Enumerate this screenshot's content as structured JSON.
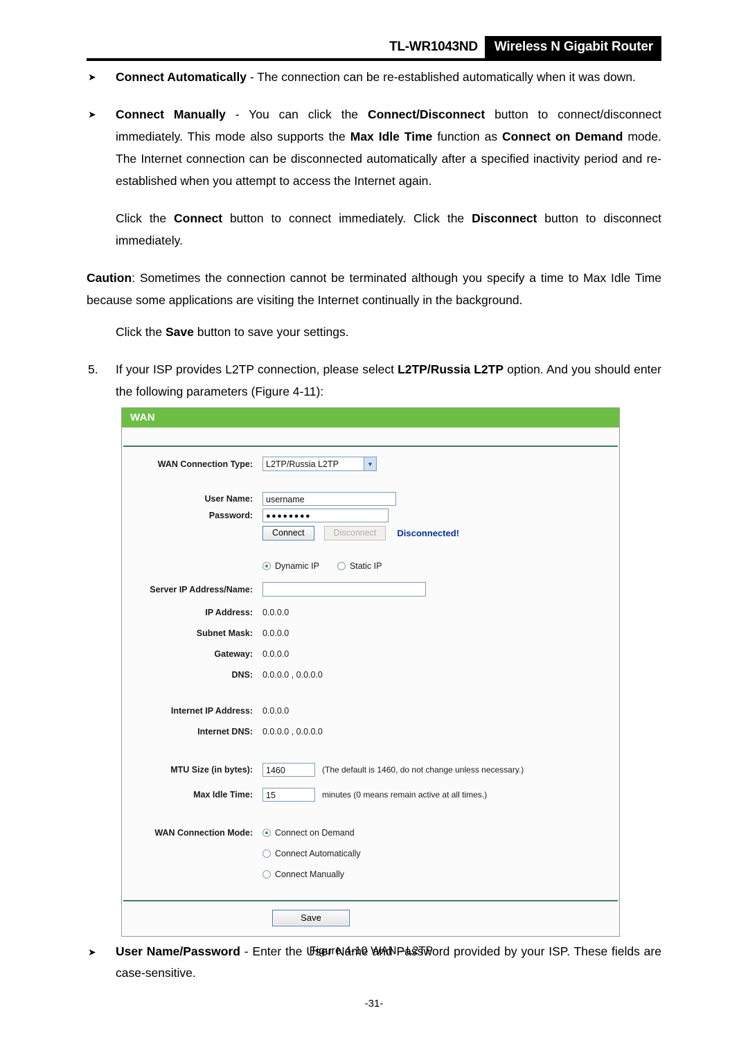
{
  "header": {
    "model": "TL-WR1043ND",
    "product": "Wireless N Gigabit Router"
  },
  "body": {
    "bullet1_bold": "Connect Automatically",
    "bullet1_dash": " - ",
    "bullet1_text": "The connection can be re-established automatically when it was down.",
    "bullet2_bold": "Connect Manually",
    "bullet2_dash": " - ",
    "bullet2_t1": "You can click the ",
    "bullet2_b1": "Connect/Disconnect",
    "bullet2_t2": " button to connect/disconnect immediately. This mode also supports the ",
    "bullet2_b2": "Max Idle Time",
    "bullet2_t3": " function as ",
    "bullet2_b3": "Connect on Demand",
    "bullet2_t4": " mode. The Internet connection can be disconnected automatically after a specified inactivity period and re-established when you attempt to access the Internet again.",
    "indent_t1": "Click the ",
    "indent_b1": "Connect",
    "indent_t2": " button to connect immediately. Click the ",
    "indent_b2": "Disconnect",
    "indent_t3": " button to disconnect immediately.",
    "caution_bold": "Caution",
    "caution_text": ": Sometimes the connection cannot be terminated although you specify a time to Max Idle Time because some applications are visiting the Internet continually in the background.",
    "save_t1": "Click the ",
    "save_b1": "Save",
    "save_t2": " button to save your settings.",
    "step_num": "5.",
    "step_t1": "If your ISP provides L2TP connection, please select ",
    "step_b1": "L2TP/Russia L2TP",
    "step_t2": " option. And you should enter the following parameters (Figure 4-11):",
    "arrow_glyph": "➤"
  },
  "router": {
    "panel_title": "WAN",
    "wan_connection_type_label": "WAN Connection Type:",
    "wan_connection_type_value": "L2TP/Russia L2TP",
    "user_name_label": "User Name:",
    "user_name_value": "username",
    "password_label": "Password:",
    "password_value": "●●●●●●●●",
    "connect_button": "Connect",
    "disconnect_button": "Disconnect",
    "status": "Disconnected!",
    "ip_mode_dynamic": "Dynamic IP",
    "ip_mode_static": "Static IP",
    "server_ip_label": "Server IP Address/Name:",
    "server_ip_value": "",
    "ip_address_label": "IP Address:",
    "ip_address_value": "0.0.0.0",
    "subnet_mask_label": "Subnet Mask:",
    "subnet_mask_value": "0.0.0.0",
    "gateway_label": "Gateway:",
    "gateway_value": "0.0.0.0",
    "dns_label": "DNS:",
    "dns_value": "0.0.0.0 , 0.0.0.0",
    "internet_ip_label": "Internet IP Address:",
    "internet_ip_value": "0.0.0.0",
    "internet_dns_label": "Internet DNS:",
    "internet_dns_value": "0.0.0.0 , 0.0.0.0",
    "mtu_label": "MTU Size (in bytes):",
    "mtu_value": "1460",
    "mtu_hint": "(The default is 1460, do not change unless necessary.)",
    "max_idle_label": "Max Idle Time:",
    "max_idle_value": "15",
    "max_idle_hint": "minutes (0 means remain active at all times.)",
    "wan_mode_label": "WAN Connection Mode:",
    "mode_on_demand": "Connect on Demand",
    "mode_automatically": "Connect Automatically",
    "mode_manually": "Connect Manually",
    "save_button": "Save",
    "dropdown_arrow": "▼",
    "accent_green": "#6cbe45",
    "status_blue": "#0a2f9c",
    "radio_dot_green": "#3a9b2e"
  },
  "figure": {
    "caption": "Figure 4-10    WAN –L2TP"
  },
  "footer": {
    "bullet_bold": "User Name/Password",
    "bullet_dash": " - ",
    "bullet_text": "Enter the User Name and Password provided by your ISP. These fields are case-sensitive.",
    "page_number": "-31-"
  }
}
